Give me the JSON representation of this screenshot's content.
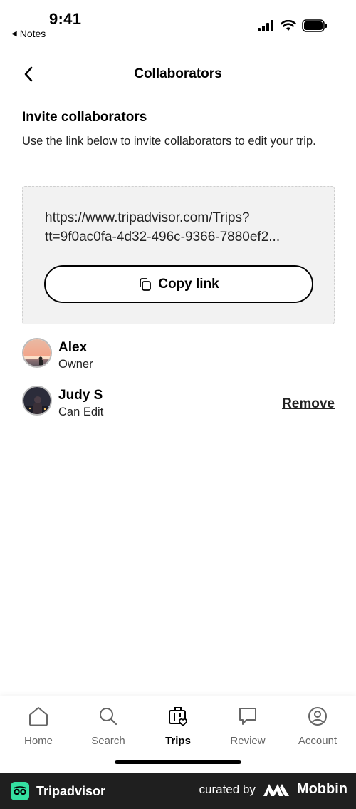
{
  "status_bar": {
    "time": "9:41",
    "back_label": "Notes",
    "icons": [
      "signal-icon",
      "wifi-icon",
      "battery-icon"
    ]
  },
  "header": {
    "title": "Collaborators",
    "back_icon": "chevron-left-icon"
  },
  "invite": {
    "title": "Invite collaborators",
    "description": "Use the link below to invite collaborators to edit your trip.",
    "url_line1": "https://www.tripadvisor.com/Trips?",
    "url_line2": "tt=9f0ac0fa-4d32-496c-9366-7880ef2...",
    "copy_label": "Copy link",
    "copy_icon": "copy-icon"
  },
  "collaborators": [
    {
      "name": "Alex",
      "role": "Owner"
    },
    {
      "name": "Judy S",
      "role": "Can Edit",
      "action": "Remove"
    }
  ],
  "tabs": [
    {
      "label": "Home",
      "icon": "home-icon",
      "active": false
    },
    {
      "label": "Search",
      "icon": "search-icon",
      "active": false
    },
    {
      "label": "Trips",
      "icon": "suitcase-heart-icon",
      "active": true
    },
    {
      "label": "Review",
      "icon": "speech-bubble-icon",
      "active": false
    },
    {
      "label": "Account",
      "icon": "user-circle-icon",
      "active": false
    }
  ],
  "footer": {
    "brand": "Tripadvisor",
    "curated_by": "curated by",
    "mobbin": "Mobbin"
  },
  "colors": {
    "brand_green": "#34e0a1",
    "footer_bg": "#1f1f1f",
    "link_box_bg": "#f2f2f2"
  }
}
